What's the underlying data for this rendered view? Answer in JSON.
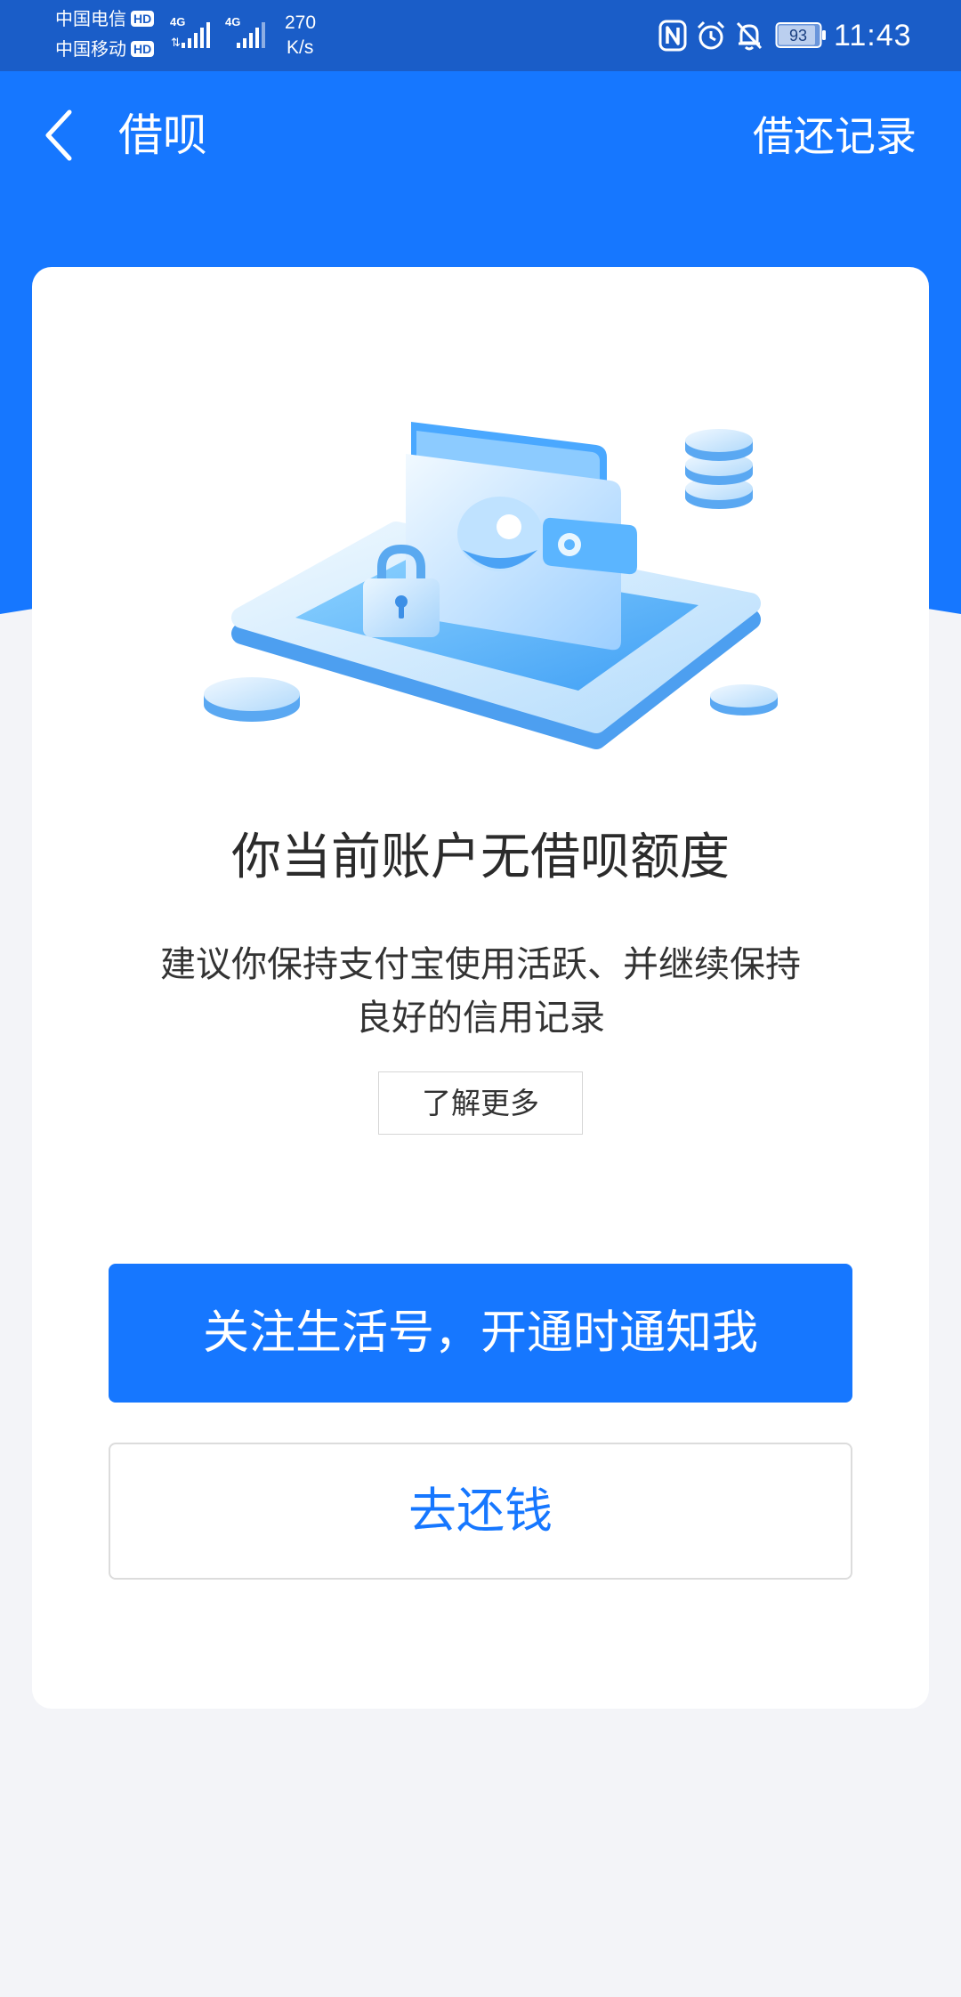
{
  "status_bar": {
    "carrier_1": "中国电信",
    "carrier_2": "中国移动",
    "hd_label": "HD",
    "network_label": "4G",
    "speed_value": "270",
    "speed_unit": "K/s",
    "battery_level": "93",
    "time": "11:43"
  },
  "header": {
    "title": "借呗",
    "records_link": "借还记录"
  },
  "main": {
    "heading": "你当前账户无借呗额度",
    "description_line_1": "建议你保持支付宝使用活跃、并继续保持",
    "description_line_2": "良好的信用记录",
    "learn_more_label": "了解更多",
    "primary_button_label": "关注生活号，开通时通知我",
    "secondary_button_label": "去还钱"
  },
  "icons": {
    "back": "chevron-left-icon",
    "nfc": "nfc-icon",
    "alarm": "alarm-icon",
    "mute": "bell-off-icon",
    "battery": "battery-icon",
    "signal": "signal-icon",
    "illustration": "locked-wallet-illustration"
  },
  "colors": {
    "status_bar": "#1a5dc8",
    "brand_blue": "#1677ff",
    "page_background": "#f3f4f8",
    "card_background": "#ffffff",
    "heading_text": "#2b2b2b",
    "button_border": "#dcdcdc"
  }
}
